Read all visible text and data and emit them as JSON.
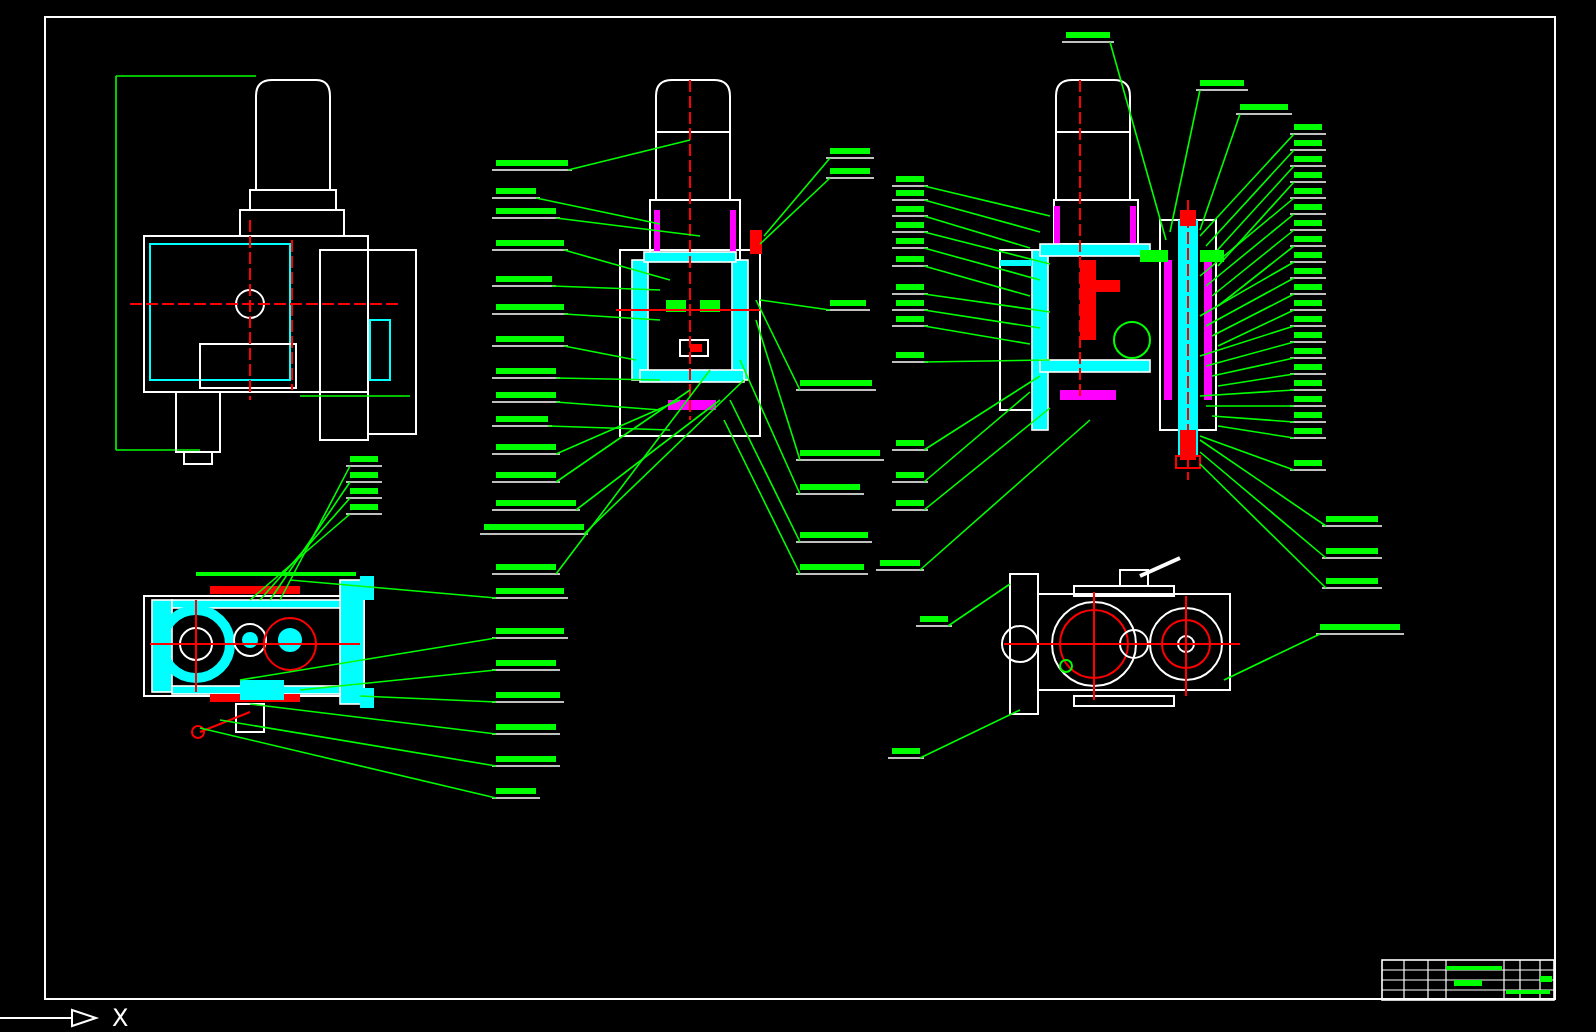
{
  "ucs_icon": {
    "axis_label": "X"
  }
}
